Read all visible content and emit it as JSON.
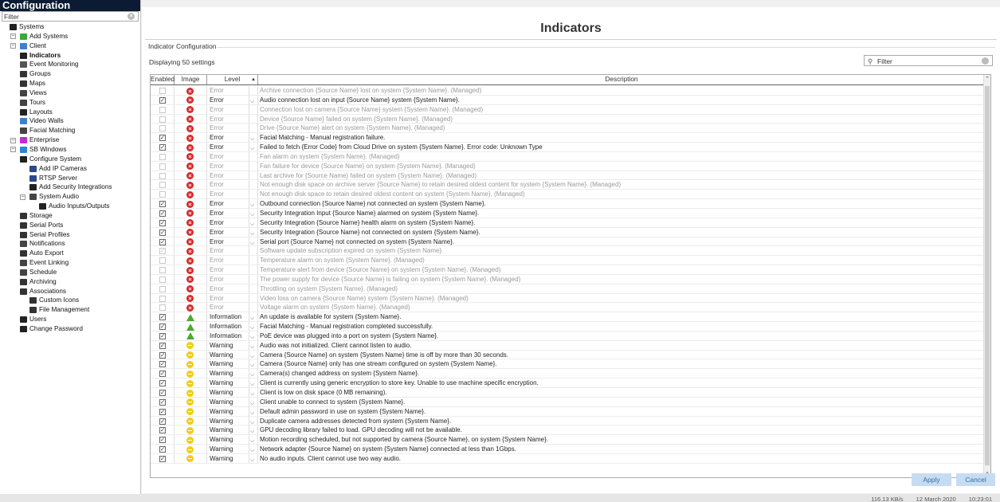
{
  "sidebar": {
    "title": "Configuration",
    "filter_placeholder": "Filter",
    "items": [
      {
        "label": "Systems",
        "level": 0,
        "icon": "#222"
      },
      {
        "label": "Add Systems",
        "level": 1,
        "icon": "#3aa83a"
      },
      {
        "label": "Client",
        "level": 1,
        "icon": "#3f7fd0"
      },
      {
        "label": "Indicators",
        "level": 2,
        "icon": "#222",
        "selected": true
      },
      {
        "label": "Event Monitoring",
        "level": 2,
        "icon": "#555"
      },
      {
        "label": "Groups",
        "level": 2,
        "icon": "#333"
      },
      {
        "label": "Maps",
        "level": 2,
        "icon": "#333"
      },
      {
        "label": "Views",
        "level": 2,
        "icon": "#444"
      },
      {
        "label": "Tours",
        "level": 2,
        "icon": "#444"
      },
      {
        "label": "Layouts",
        "level": 2,
        "icon": "#222"
      },
      {
        "label": "Video Walls",
        "level": 2,
        "icon": "#3f7fd0"
      },
      {
        "label": "Facial Matching",
        "level": 2,
        "icon": "#444"
      },
      {
        "label": "Enterprise",
        "level": 1,
        "icon": "#c02ccf"
      },
      {
        "label": "SB Windows",
        "level": 1,
        "icon": "#2c86d6"
      },
      {
        "label": "Configure System",
        "level": 2,
        "icon": "#222"
      },
      {
        "label": "Add IP Cameras",
        "level": 3,
        "icon": "#2a4a8c"
      },
      {
        "label": "RTSP Server",
        "level": 3,
        "icon": "#2a4a8c"
      },
      {
        "label": "Add Security Integrations",
        "level": 3,
        "icon": "#222"
      },
      {
        "label": "System Audio",
        "level": 3,
        "icon": "#444"
      },
      {
        "label": "Audio Inputs/Outputs",
        "level": 4,
        "icon": "#222"
      },
      {
        "label": "Storage",
        "level": 2,
        "icon": "#333"
      },
      {
        "label": "Serial Ports",
        "level": 2,
        "icon": "#333"
      },
      {
        "label": "Serial Profiles",
        "level": 2,
        "icon": "#333"
      },
      {
        "label": "Notifications",
        "level": 2,
        "icon": "#444"
      },
      {
        "label": "Auto Export",
        "level": 2,
        "icon": "#333"
      },
      {
        "label": "Event Linking",
        "level": 2,
        "icon": "#444"
      },
      {
        "label": "Schedule",
        "level": 2,
        "icon": "#444"
      },
      {
        "label": "Archiving",
        "level": 2,
        "icon": "#333"
      },
      {
        "label": "Associations",
        "level": 2,
        "icon": "#333"
      },
      {
        "label": "Custom Icons",
        "level": 3,
        "icon": "#333"
      },
      {
        "label": "File Management",
        "level": 3,
        "icon": "#333"
      },
      {
        "label": "Users",
        "level": 2,
        "icon": "#222"
      },
      {
        "label": "Change Password",
        "level": 2,
        "icon": "#222"
      }
    ]
  },
  "main": {
    "title": "Indicators",
    "section_title": "Indicator Configuration",
    "count_text": "Displaying 50 settings",
    "filter_placeholder": "Filter",
    "columns": {
      "enabled": "Enabled",
      "image": "Image",
      "level": "Level",
      "description": "Description"
    },
    "rows": [
      {
        "enabled": false,
        "type": "err",
        "level": "Error",
        "desc": "Archive connection {Source Name} lost on system {System Name}. (Managed)",
        "dis": true
      },
      {
        "enabled": true,
        "type": "err",
        "level": "Error",
        "desc": "Audio connection lost on input {Source Name} system {System Name}.",
        "dis": false
      },
      {
        "enabled": false,
        "type": "err",
        "level": "Error",
        "desc": "Connection lost on camera {Source Name} system {System Name}. (Managed)",
        "dis": true
      },
      {
        "enabled": false,
        "type": "err",
        "level": "Error",
        "desc": "Device {Source Name} failed on system {System Name}. (Managed)",
        "dis": true
      },
      {
        "enabled": false,
        "type": "err",
        "level": "Error",
        "desc": "Drive {Source Name} alert on system {System Name}. (Managed)",
        "dis": true
      },
      {
        "enabled": true,
        "type": "err",
        "level": "Error",
        "desc": "Facial Matching - Manual registration failure.",
        "dis": false
      },
      {
        "enabled": true,
        "type": "err",
        "level": "Error",
        "desc": "Failed to fetch {Error Code} from Cloud Drive on system {System Name}. Error code: Unknown Type",
        "dis": false
      },
      {
        "enabled": false,
        "type": "err",
        "level": "Error",
        "desc": "Fan alarm on system {System Name}. (Managed)",
        "dis": true
      },
      {
        "enabled": false,
        "type": "err",
        "level": "Error",
        "desc": "Fan failure for device {Source Name} on system {System Name}. (Managed)",
        "dis": true
      },
      {
        "enabled": false,
        "type": "err",
        "level": "Error",
        "desc": "Last archive for {Source Name} failed on system {System Name}. (Managed)",
        "dis": true
      },
      {
        "enabled": false,
        "type": "err",
        "level": "Error",
        "desc": "Not enough disk space on archive server {Source Name} to retain desired oldest content for system {System Name}. (Managed)",
        "dis": true
      },
      {
        "enabled": false,
        "type": "err",
        "level": "Error",
        "desc": "Not enough disk space to retain desired oldest content on system {System Name}. (Managed)",
        "dis": true
      },
      {
        "enabled": true,
        "type": "err",
        "level": "Error",
        "desc": "Outbound connection {Source Name} not connected on system {System Name}.",
        "dis": false
      },
      {
        "enabled": true,
        "type": "err",
        "level": "Error",
        "desc": "Security Integration Input {Source Name} alarmed on system {System Name}.",
        "dis": false
      },
      {
        "enabled": true,
        "type": "err",
        "level": "Error",
        "desc": "Security Integration {Source Name} health alarm on system {System Name}.",
        "dis": false
      },
      {
        "enabled": true,
        "type": "err",
        "level": "Error",
        "desc": "Security Integration {Source Name} not connected on system {System Name}.",
        "dis": false
      },
      {
        "enabled": true,
        "type": "err",
        "level": "Error",
        "desc": "Serial port {Source Name} not connected on system {System Name}.",
        "dis": false
      },
      {
        "enabled": true,
        "type": "err",
        "level": "Error",
        "desc": "Software update subscription expired on system {System Name}.",
        "dis": true
      },
      {
        "enabled": false,
        "type": "err",
        "level": "Error",
        "desc": "Temperature alarm on system {System Name}. (Managed)",
        "dis": true
      },
      {
        "enabled": false,
        "type": "err",
        "level": "Error",
        "desc": "Temperature alert from device {Source Name} on system {System Name}. (Managed)",
        "dis": true
      },
      {
        "enabled": false,
        "type": "err",
        "level": "Error",
        "desc": "The power supply for device {Source Name} is failing on system {System Name}. (Managed)",
        "dis": true
      },
      {
        "enabled": false,
        "type": "err",
        "level": "Error",
        "desc": "Throttling on system {System Name}. (Managed)",
        "dis": true
      },
      {
        "enabled": false,
        "type": "err",
        "level": "Error",
        "desc": "Video loss on camera {Source Name} system {System Name}. (Managed)",
        "dis": true
      },
      {
        "enabled": false,
        "type": "err",
        "level": "Error",
        "desc": "Voltage alarm on system {System Name}. (Managed)",
        "dis": true
      },
      {
        "enabled": true,
        "type": "info",
        "level": "Information",
        "desc": "An update is available for system {System Name}.",
        "dis": false
      },
      {
        "enabled": true,
        "type": "info",
        "level": "Information",
        "desc": "Facial Matching - Manual registration completed successfully.",
        "dis": false
      },
      {
        "enabled": true,
        "type": "info",
        "level": "Information",
        "desc": "PoE device was plugged into a port on system {System Name}.",
        "dis": false
      },
      {
        "enabled": true,
        "type": "warn",
        "level": "Warning",
        "desc": "Audio was not initialized. Client cannot listen to audio.",
        "dis": false
      },
      {
        "enabled": true,
        "type": "warn",
        "level": "Warning",
        "desc": "Camera {Source Name} on system {System Name} time is off by more than 30 seconds.",
        "dis": false
      },
      {
        "enabled": true,
        "type": "warn",
        "level": "Warning",
        "desc": "Camera {Source Name} only has one stream configured on system {System Name}.",
        "dis": false
      },
      {
        "enabled": true,
        "type": "warn",
        "level": "Warning",
        "desc": "Camera(s) changed address on system {System Name}.",
        "dis": false
      },
      {
        "enabled": true,
        "type": "warn",
        "level": "Warning",
        "desc": "Client is currently using generic encryption to store key. Unable to use machine specific encryption.",
        "dis": false
      },
      {
        "enabled": true,
        "type": "warn",
        "level": "Warning",
        "desc": "Client is low on disk space (0 MB remaining).",
        "dis": false
      },
      {
        "enabled": true,
        "type": "warn",
        "level": "Warning",
        "desc": "Client unable to connect to system {System Name}.",
        "dis": false
      },
      {
        "enabled": true,
        "type": "warn",
        "level": "Warning",
        "desc": "Default admin password in use on system {System Name}.",
        "dis": false
      },
      {
        "enabled": true,
        "type": "warn",
        "level": "Warning",
        "desc": "Duplicate camera addresses detected from system {System Name}.",
        "dis": false
      },
      {
        "enabled": true,
        "type": "warn",
        "level": "Warning",
        "desc": "GPU decoding library failed to load. GPU decoding will not be available.",
        "dis": false
      },
      {
        "enabled": true,
        "type": "warn",
        "level": "Warning",
        "desc": "Motion recording scheduled, but not supported by camera {Source Name}, on system {System Name}.",
        "dis": false
      },
      {
        "enabled": true,
        "type": "warn",
        "level": "Warning",
        "desc": "Network adapter {Source Name} on system {System Name} connected at less than 1Gbps.",
        "dis": false
      },
      {
        "enabled": true,
        "type": "warn",
        "level": "Warning",
        "desc": "No audio inputs. Client cannot use two way audio.",
        "dis": false
      }
    ]
  },
  "buttons": {
    "apply": "Apply",
    "cancel": "Cancel"
  },
  "status": {
    "rate": "116.13 KB/s",
    "date": "12 March 2020",
    "time": "10:23:01"
  }
}
